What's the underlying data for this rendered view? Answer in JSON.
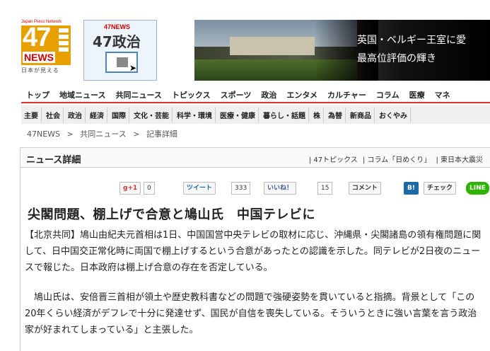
{
  "header": {
    "logo": {
      "tag": "Japan Press Network",
      "num": "47",
      "news": "NEWS",
      "sub": "日本が見える"
    },
    "seiji": {
      "t1": "47NEWS",
      "t2": "47政治"
    },
    "banner": {
      "line1": "英国・ベルギー王室に愛",
      "line2": "最高位評価の輝き"
    }
  },
  "nav_main": [
    "トップ",
    "地域ニュース",
    "共同ニュース",
    "トピックス",
    "スポーツ",
    "政治",
    "エンタメ",
    "カルチャー",
    "コラム",
    "医療",
    "マネ"
  ],
  "nav_sub": [
    "主要",
    "社会",
    "政治",
    "経済",
    "国際",
    "文化・芸能",
    "科学・環境",
    "医療・健康",
    "暮らし・話題",
    "株",
    "為替",
    "新商品",
    "おくやみ"
  ],
  "breadcrumb": {
    "home": "47NEWS",
    "sep1": ">",
    "section": "共同ニュース",
    "sep2": ">",
    "current": "記事詳細"
  },
  "box": {
    "title": "ニュース詳細",
    "links": [
      "| 47トピックス",
      "| コラム「日めくり」",
      "| 東日本大震災"
    ]
  },
  "social": {
    "gplus_label": "g+1",
    "gplus_count": "0",
    "tweet_label": "ツイート",
    "tweet_count": "333",
    "like_label": "いいね！",
    "like_count": "15",
    "comment_label": "コメント",
    "hatena_label": "B!",
    "check_label": "チェック",
    "line_label": "LINE"
  },
  "article": {
    "headline": "尖閣問題、棚上げで合意と鳩山氏　中国テレビに",
    "p1": "【北京共同】鳩山由紀夫元首相は1日、中国国営中央テレビの取材に応じ、沖縄県・尖閣諸島の領有権問題に関して、日中国交正常化時に両国で棚上げするという合意があったとの認識を示した。同テレビが2日夜のニュースで報じた。日本政府は棚上げ合意の存在を否定している。",
    "p2": "　鳩山氏は、安倍晋三首相が領土や歴史教科書などの問題で強硬姿勢を貫いていると指摘。背景として「この20年くらい経済がデフレで十分に発達せず、国民が自信を喪失している。そういうときに強い言葉を言う政治家が好まれてしまっている」と主張した。"
  }
}
